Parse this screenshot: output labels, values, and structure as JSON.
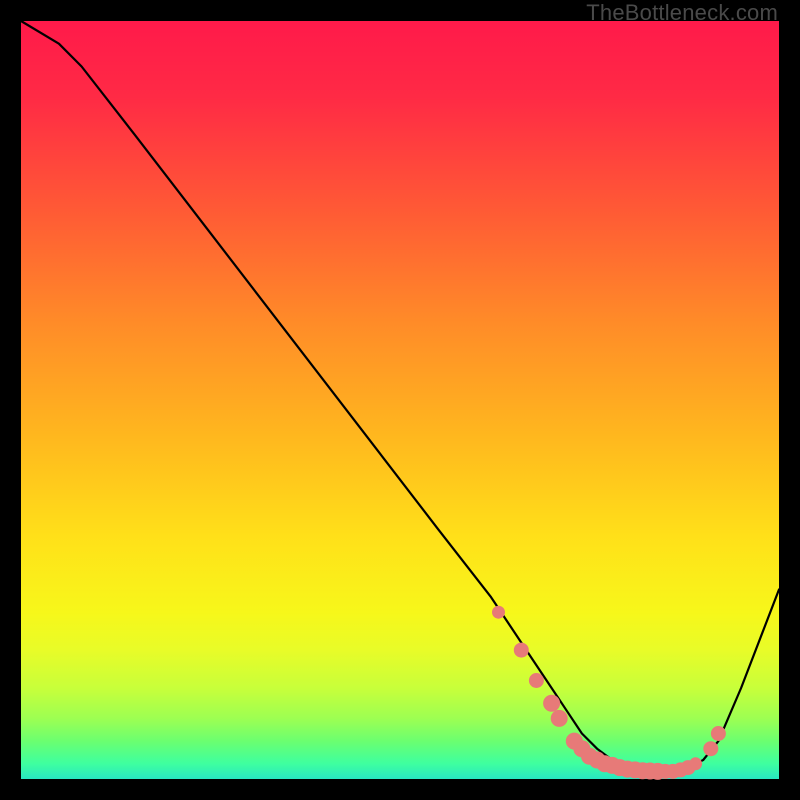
{
  "watermark": "TheBottleneck.com",
  "colors": {
    "curve_stroke": "#000000",
    "marker_fill": "#e77a78",
    "marker_stroke": "#e77a78"
  },
  "chart_data": {
    "type": "line",
    "title": "",
    "xlabel": "",
    "ylabel": "",
    "xlim": [
      0,
      100
    ],
    "ylim": [
      0,
      100
    ],
    "series": [
      {
        "name": "bottleneck-curve",
        "x": [
          0,
          5,
          8,
          15,
          25,
          35,
          45,
          55,
          62,
          66,
          70,
          72,
          74,
          76,
          78,
          80,
          82,
          84,
          86,
          88,
          90,
          92,
          95,
          100
        ],
        "y": [
          100,
          97,
          94,
          85,
          72,
          59,
          46,
          33,
          24,
          18,
          12,
          9,
          6,
          4,
          2.5,
          1.5,
          1,
          1,
          1,
          1.5,
          2.5,
          5,
          12,
          25
        ]
      }
    ],
    "markers": {
      "comment": "salmon dots near the valley",
      "x": [
        63,
        66,
        68,
        70,
        71,
        73,
        74,
        75,
        76,
        77,
        78,
        79,
        80,
        81,
        82,
        83,
        84,
        85,
        86,
        87,
        88,
        89,
        91,
        92
      ],
      "y": [
        22,
        17,
        13,
        10,
        8,
        5,
        4,
        3,
        2.5,
        2,
        1.8,
        1.5,
        1.3,
        1.2,
        1.1,
        1.05,
        1,
        1,
        1,
        1.2,
        1.5,
        2,
        4,
        6
      ],
      "r": [
        6,
        7,
        7,
        8,
        8,
        8,
        8,
        8,
        8,
        8,
        8,
        8,
        8,
        8,
        8,
        8,
        8,
        7,
        7,
        7,
        7,
        6,
        7,
        7
      ]
    }
  }
}
